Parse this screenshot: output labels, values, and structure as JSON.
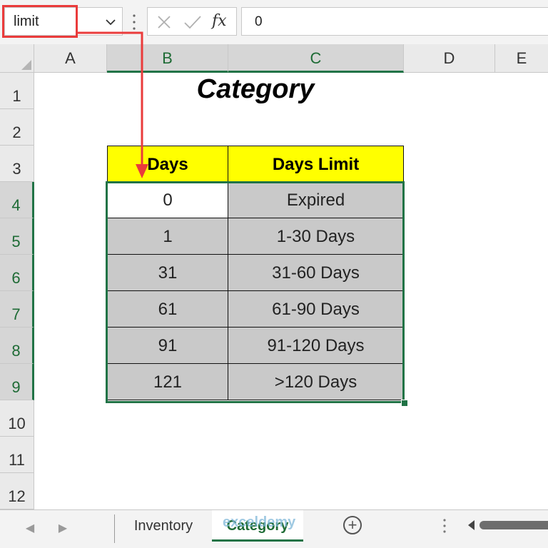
{
  "formula_bar": {
    "name_box": "limit",
    "formula_value": "0",
    "cancel_icon": "x-icon",
    "enter_icon": "check-icon",
    "function_label": "fx"
  },
  "columns": [
    "A",
    "B",
    "C",
    "D",
    "E"
  ],
  "rows": [
    "1",
    "2",
    "3",
    "4",
    "5",
    "6",
    "7",
    "8",
    "9",
    "10",
    "11",
    "12"
  ],
  "title": "Category",
  "table": {
    "headers": [
      "Days",
      "Days Limit"
    ],
    "rows": [
      [
        "0",
        "Expired"
      ],
      [
        "1",
        "1-30 Days"
      ],
      [
        "31",
        "31-60 Days"
      ],
      [
        "61",
        "61-90 Days"
      ],
      [
        "91",
        "91-120 Days"
      ],
      [
        "121",
        ">120 Days"
      ]
    ]
  },
  "sheet_tabs": [
    "Inventory",
    "Category"
  ],
  "active_tab": "Category",
  "watermark": "exceldemy",
  "colors": {
    "header_fill": "#ffff00",
    "range_fill": "#c9c9c9",
    "selection_green": "#217346",
    "annotation_red": "#ea3b3b"
  }
}
